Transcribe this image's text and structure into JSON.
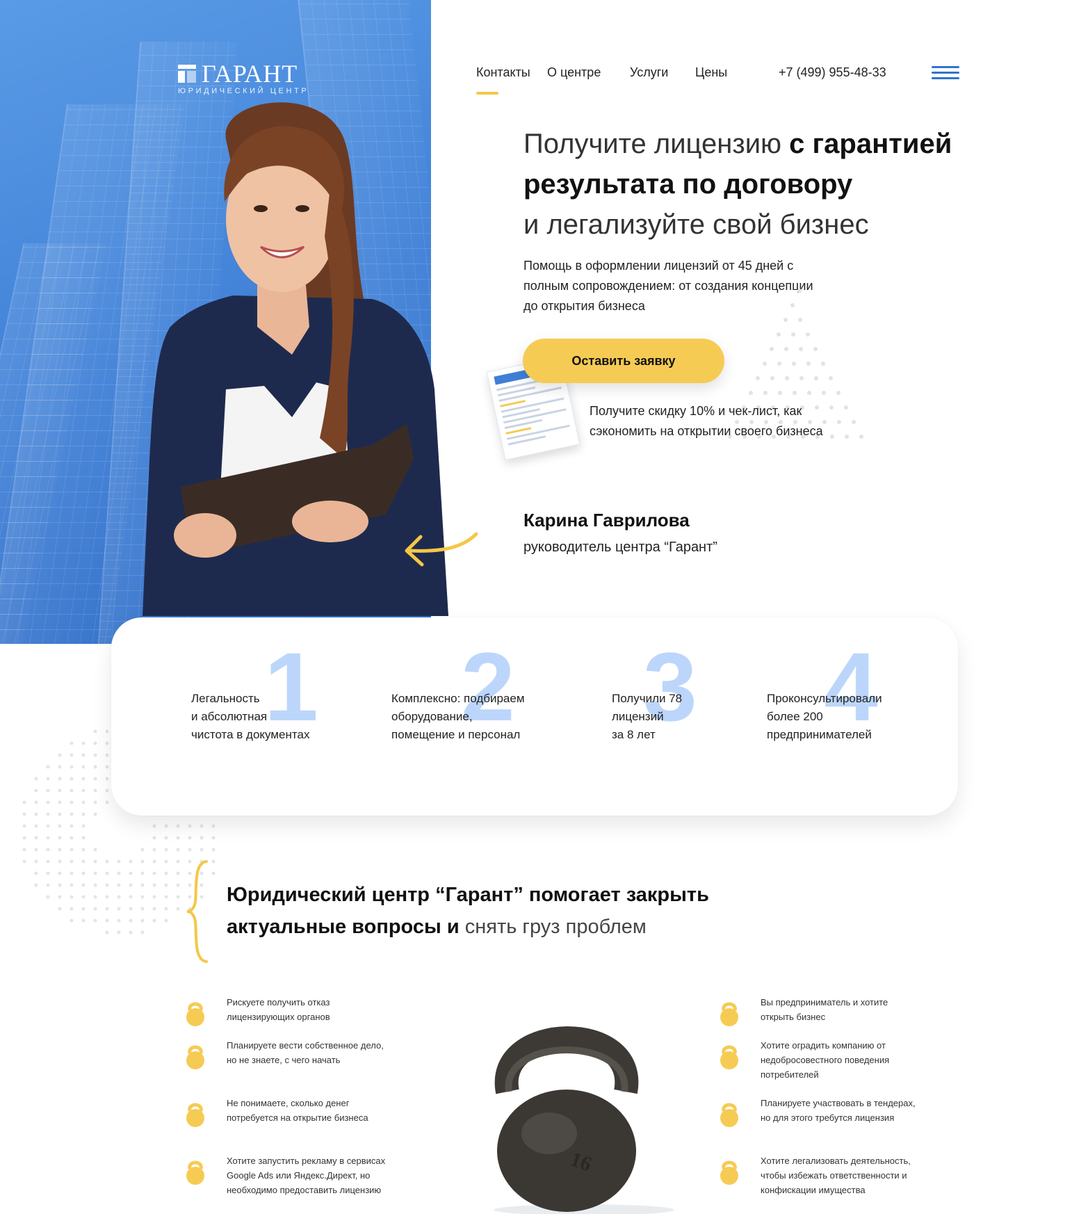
{
  "brand": {
    "name": "ГАРАНТ",
    "subtitle": "ЮРИДИЧЕСКИЙ ЦЕНТР"
  },
  "nav": {
    "items": [
      {
        "label": "Контакты",
        "active": true
      },
      {
        "label": "О центре"
      },
      {
        "label": "Услуги"
      },
      {
        "label": "Цены"
      }
    ],
    "phone": "+7 (499) 955-48-33"
  },
  "hero": {
    "headline_part1": "Получите лицензию ",
    "headline_bold": "с гарантией результата по договору",
    "headline_part2": "и легализуйте свой бизнес",
    "description": "Помощь в оформлении лицензий от 45 дней с полным сопровождением: от создания концепции до открытия бизнеса",
    "cta_label": "Оставить заявку",
    "discount_text": "Получите скидку 10% и чек-лист, как сэкономить на открытии своего бизнеса",
    "person_name": "Карина Гаврилова",
    "person_role": "руководитель центра “Гарант”"
  },
  "stats": [
    {
      "number": "1",
      "text_lines": [
        "Легальность",
        "и абсолютная",
        "чистота в документах"
      ]
    },
    {
      "number": "2",
      "text_lines": [
        "Комплексно: подбираем",
        "оборудование,",
        "помещение и персонал"
      ]
    },
    {
      "number": "3",
      "text_lines": [
        "Получили 78",
        "лицензий",
        "за 8 лет"
      ]
    },
    {
      "number": "4",
      "text_lines": [
        "Проконсультировали",
        "более 200",
        "предпринимателей"
      ]
    }
  ],
  "section": {
    "title_bold1": "Юридический центр “Гарант” помогает закрыть",
    "title_bold2": "актуальные вопросы и ",
    "title_thin": "снять груз проблем"
  },
  "problems_left": [
    "Рискуете получить отказ лицензирующих органов",
    "Планируете вести собственное дело, но не знаете, с чего начать",
    "Не понимаете, сколько денег потребуется на открытие бизнеса",
    "Хотите запустить рекламу в сервисах Google Ads или Яндекс.Директ, но необходимо предоставить лицензию"
  ],
  "problems_right": [
    "Вы предприниматель и хотите открыть бизнес",
    "Хотите оградить компанию от недобросовестного поведения потребителей",
    "Планируете участвовать в тендерах, но для этого требутся лицензия",
    "Хотите легализовать деятельность, чтобы избежать ответственности и конфискации имущества"
  ],
  "kettlebell_mark": "16",
  "colors": {
    "brand_blue": "#3f7fd6",
    "accent_yellow": "#f6cb54",
    "number_blue": "#bcd6fb"
  }
}
